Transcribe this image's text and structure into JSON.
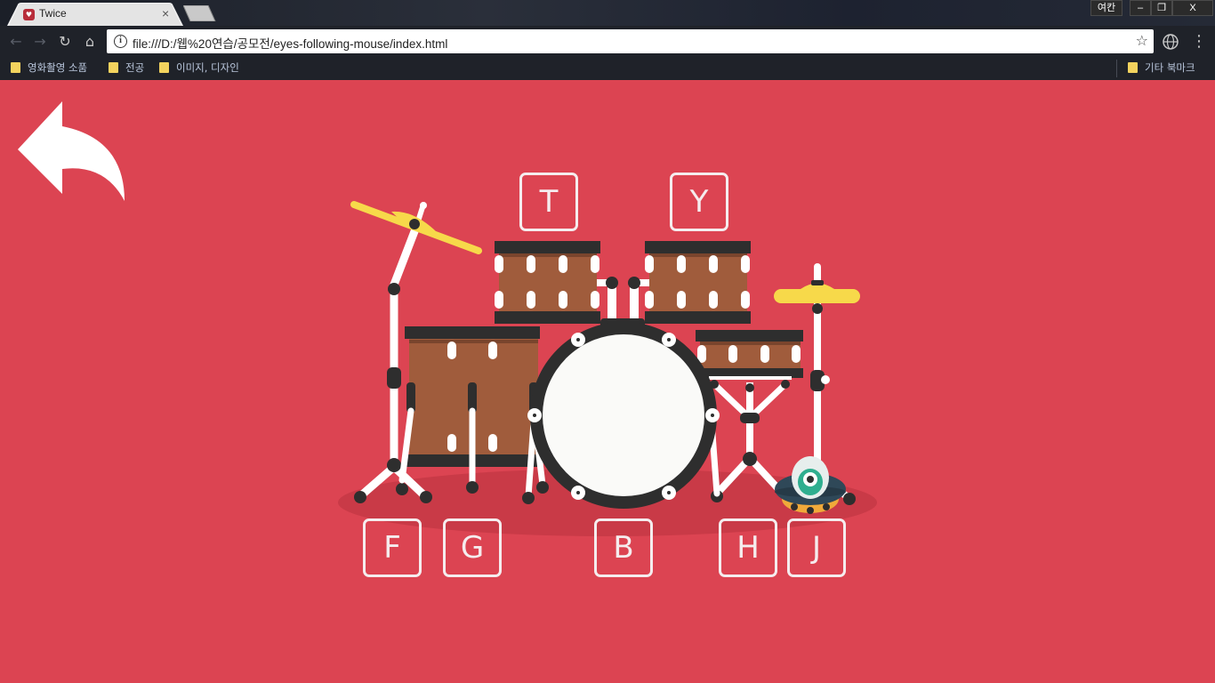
{
  "browser": {
    "tab_title": "Twice",
    "tab_close": "×",
    "ime_indicator": "여칸",
    "window_buttons": {
      "minimize": "–",
      "restore": "❐",
      "close": "X"
    },
    "url": "file:///D:/웹%20연습/공모전/eyes-following-mouse/index.html",
    "bookmarks": [
      "영화촬영 소품",
      "전공",
      "이미지, 디자인"
    ],
    "other_bookmarks": "기타 북마크"
  },
  "keys": {
    "tom1": "T",
    "tom2": "Y",
    "hihat": "F",
    "floor_tom": "G",
    "bass": "B",
    "snare": "H",
    "ride": "J"
  },
  "colors": {
    "background": "#dc4452",
    "drum_wood": "#a05c3c",
    "hardware": "#2e2e2e",
    "cymbal": "#f7d94a",
    "bass_head": "#fafaf8"
  }
}
